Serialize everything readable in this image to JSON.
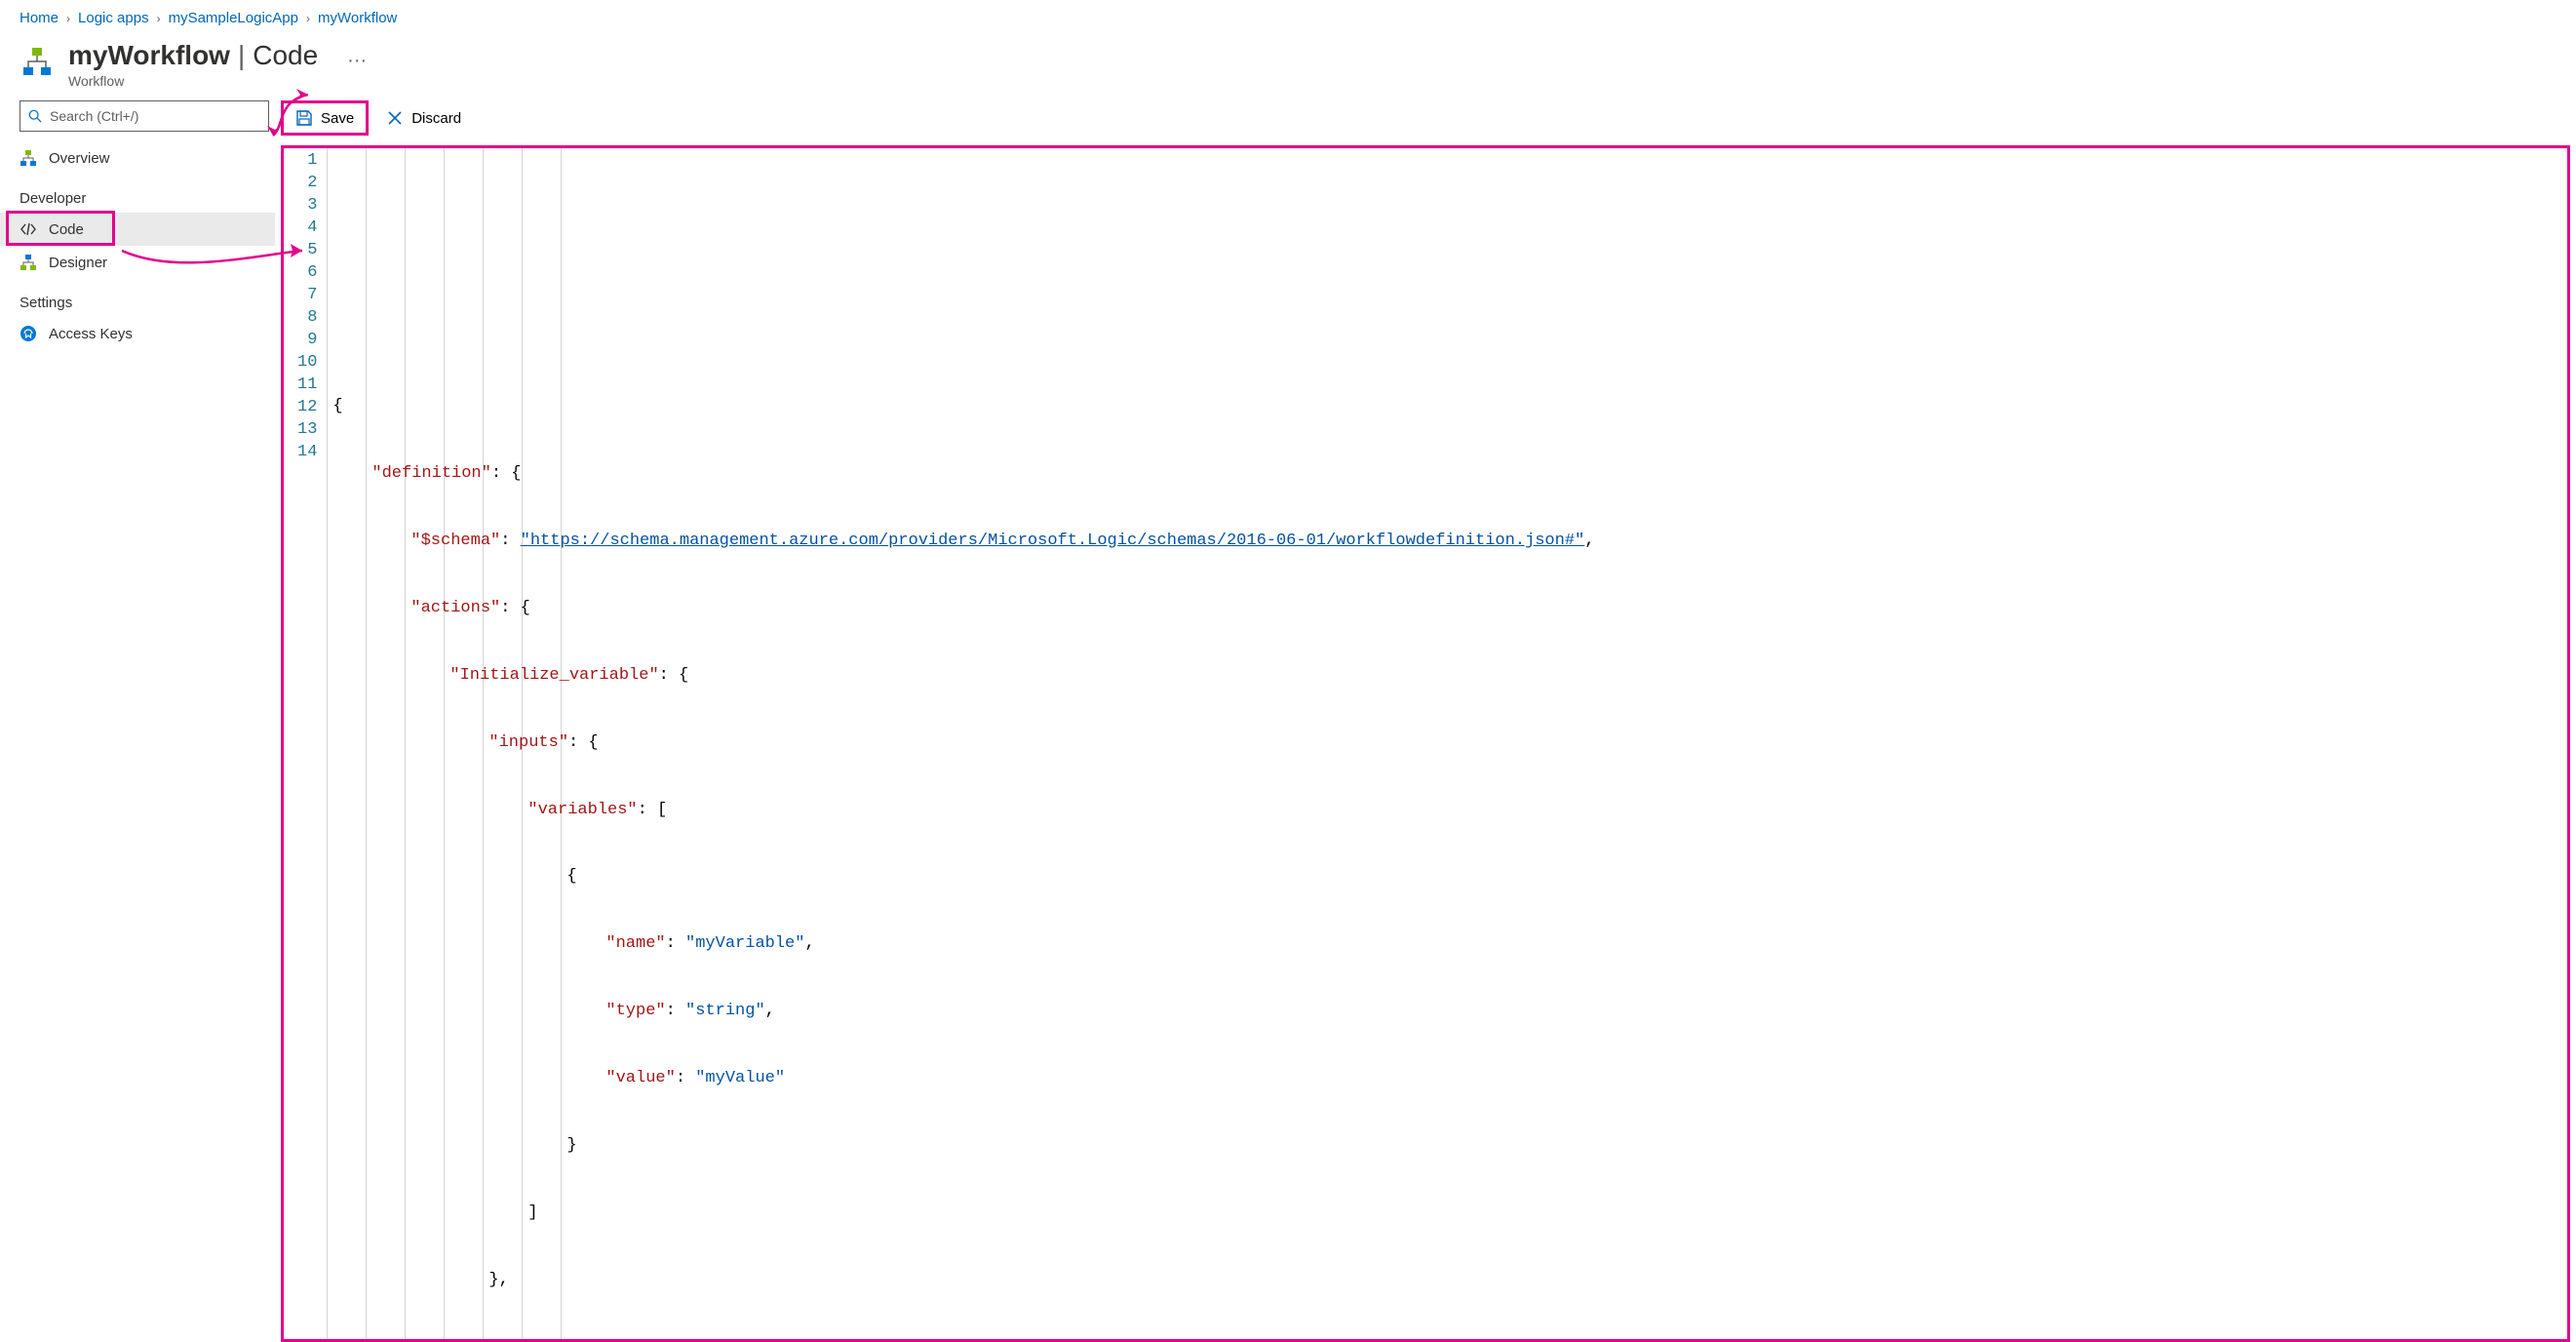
{
  "breadcrumb": [
    {
      "label": "Home"
    },
    {
      "label": "Logic apps"
    },
    {
      "label": "mySampleLogicApp"
    },
    {
      "label": "myWorkflow"
    }
  ],
  "header": {
    "title_bold": "myWorkflow",
    "title_rest": "Code",
    "subtitle": "Workflow",
    "more": "···"
  },
  "search": {
    "placeholder": "Search (Ctrl+/)"
  },
  "sidebar": {
    "items": [
      {
        "label": "Overview",
        "icon": "workflow-icon"
      }
    ],
    "section1": "Developer",
    "dev_items": [
      {
        "label": "Code",
        "icon": "code-icon",
        "active": true
      },
      {
        "label": "Designer",
        "icon": "designer-icon"
      }
    ],
    "section2": "Settings",
    "settings_items": [
      {
        "label": "Access Keys",
        "icon": "keys-icon"
      }
    ]
  },
  "toolbar": {
    "save_label": "Save",
    "discard_label": "Discard"
  },
  "editor": {
    "line_numbers": [
      "1",
      "2",
      "3",
      "4",
      "5",
      "6",
      "7",
      "8",
      "9",
      "10",
      "11",
      "12",
      "13",
      "14"
    ],
    "json_content": {
      "definition": {
        "$schema": "https://schema.management.azure.com/providers/Microsoft.Logic/schemas/2016-06-01/workflowdefinition.json#",
        "actions": {
          "Initialize_variable": {
            "inputs": {
              "variables": [
                {
                  "name": "myVariable",
                  "type": "string",
                  "value": "myValue"
                }
              ]
            }
          }
        }
      }
    },
    "tokens": {
      "l1": "{",
      "l2_k": "\"definition\"",
      "l2_r": ": {",
      "l3_k": "\"$schema\"",
      "l3_c": ": ",
      "l3_v": "\"https://schema.management.azure.com/providers/Microsoft.Logic/schemas/2016-06-01/workflowdefinition.json#\"",
      "l3_e": ",",
      "l4_k": "\"actions\"",
      "l4_r": ": {",
      "l5_k": "\"Initialize_variable\"",
      "l5_r": ": {",
      "l6_k": "\"inputs\"",
      "l6_r": ": {",
      "l7_k": "\"variables\"",
      "l7_r": ": [",
      "l8": "{",
      "l9_k": "\"name\"",
      "l9_c": ": ",
      "l9_v": "\"myVariable\"",
      "l9_e": ",",
      "l10_k": "\"type\"",
      "l10_c": ": ",
      "l10_v": "\"string\"",
      "l10_e": ",",
      "l11_k": "\"value\"",
      "l11_c": ": ",
      "l11_v": "\"myValue\"",
      "l12": "}",
      "l13": "]",
      "l14": "},"
    }
  }
}
